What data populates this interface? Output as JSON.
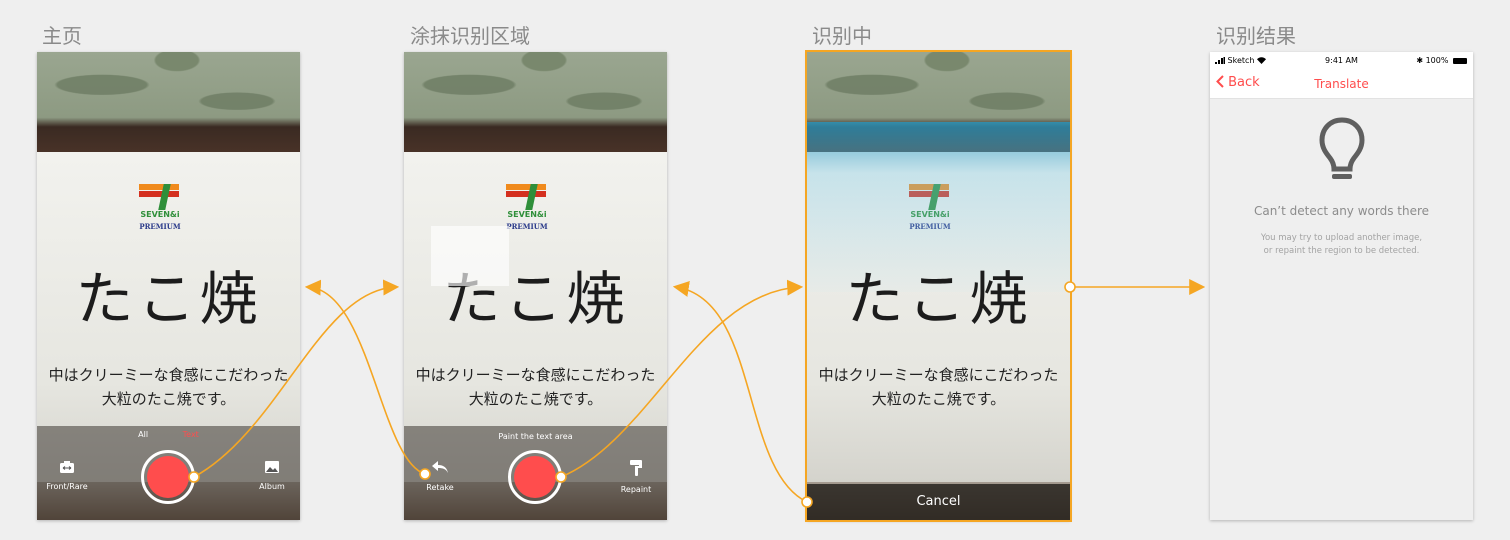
{
  "sections": [
    {
      "title": "主页"
    },
    {
      "title": "涂抹识别区域"
    },
    {
      "title": "识别中"
    },
    {
      "title": "识别结果"
    }
  ],
  "photo": {
    "brand": "SEVEN&i",
    "premium": "PREMIUM",
    "big_text": "たこ焼",
    "line1": "中はクリーミーな食感にこだわった",
    "line2": "大粒のたこ焼です。"
  },
  "home": {
    "modes": [
      "All",
      "Text"
    ],
    "active_mode": "Text",
    "front_rear_label": "Front/Rare",
    "album_label": "Album"
  },
  "paint": {
    "hint": "Paint the text area",
    "retake_label": "Retake",
    "repaint_label": "Repaint"
  },
  "recognizing": {
    "cancel_label": "Cancel"
  },
  "result": {
    "status_left": "Sketch",
    "status_time": "9:41 AM",
    "status_battery": "100%",
    "back_label": "Back",
    "title": "Translate",
    "empty_title": "Can’t detect any words there",
    "empty_desc_1": "You may try to upload another image,",
    "empty_desc_2": "or repaint the region to be detected."
  },
  "colors": {
    "accent": "#ff4d4d",
    "flow_line": "#f5a623",
    "background": "#efefef"
  },
  "icons": [
    "camera-flip-icon",
    "album-icon",
    "retake-icon",
    "repaint-icon",
    "lightbulb-icon",
    "chevron-left-icon",
    "signal-icon",
    "wifi-icon",
    "bluetooth-icon",
    "battery-icon"
  ]
}
